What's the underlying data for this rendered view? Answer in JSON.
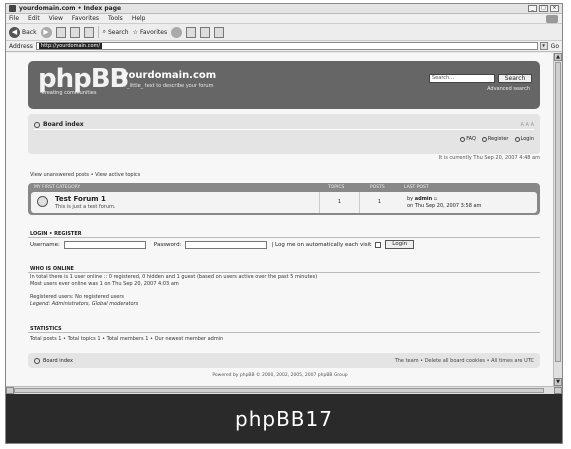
{
  "window": {
    "title": "yourdomain.com • Index page"
  },
  "menu": [
    "File",
    "Edit",
    "View",
    "Favorites",
    "Tools",
    "Help"
  ],
  "toolbar": {
    "back": "Back",
    "search": "Search",
    "favorites": "Favorites"
  },
  "address": {
    "label": "Address",
    "url": "http://yourdomain.com/",
    "go": "Go"
  },
  "header": {
    "logo": "phpBB",
    "logo_tagline": "creating communities",
    "site_name": "yourdomain.com",
    "site_desc": "A _little_ text to describe your forum",
    "search_placeholder": "Search…",
    "search_button": "Search",
    "advanced_search": "Advanced search"
  },
  "nav": {
    "breadcrumb": "Board index",
    "font_size": "A A A",
    "faq": "FAQ",
    "register": "Register",
    "login": "Login",
    "current_time": "It is currently Thu Sep 20, 2007 4:48 am"
  },
  "view_links": "View unanswered posts • View active topics",
  "forum_table": {
    "headers": {
      "category": "MY FIRST CATEGORY",
      "topics": "TOPICS",
      "posts": "POSTS",
      "last_post": "LAST POST"
    },
    "forum": {
      "name": "Test Forum 1",
      "desc": "This is just a test forum.",
      "topics": "1",
      "posts": "1",
      "last_by_prefix": "by ",
      "last_by_user": "admin",
      "last_date": "on Thu Sep 20, 2007 3:58 am"
    }
  },
  "login": {
    "title": "LOGIN • REGISTER",
    "username_label": "Username:",
    "password_label": "Password:",
    "auto_label": "| Log me on automatically each visit",
    "button": "Login"
  },
  "who_is_online": {
    "title": "WHO IS ONLINE",
    "line1": "In total there is 1 user online :: 0 registered, 0 hidden and 1 guest (based on users active over the past 5 minutes)",
    "line2": "Most users ever online was 1 on Thu Sep 20, 2007 4:03 am",
    "registered": "Registered users: No registered users",
    "legend_prefix": "Legend: ",
    "legend_admins": "Administrators",
    "legend_mods": "Global moderators"
  },
  "statistics": {
    "title": "STATISTICS",
    "line": "Total posts 1 • Total topics 1 • Total members 1 • Our newest member admin"
  },
  "footer": {
    "breadcrumb": "Board index",
    "links": "The team • Delete all board cookies • All times are UTC",
    "powered": "Powered by phpBB © 2000, 2002, 2005, 2007 phpBB Group"
  },
  "caption": "phpBB17"
}
